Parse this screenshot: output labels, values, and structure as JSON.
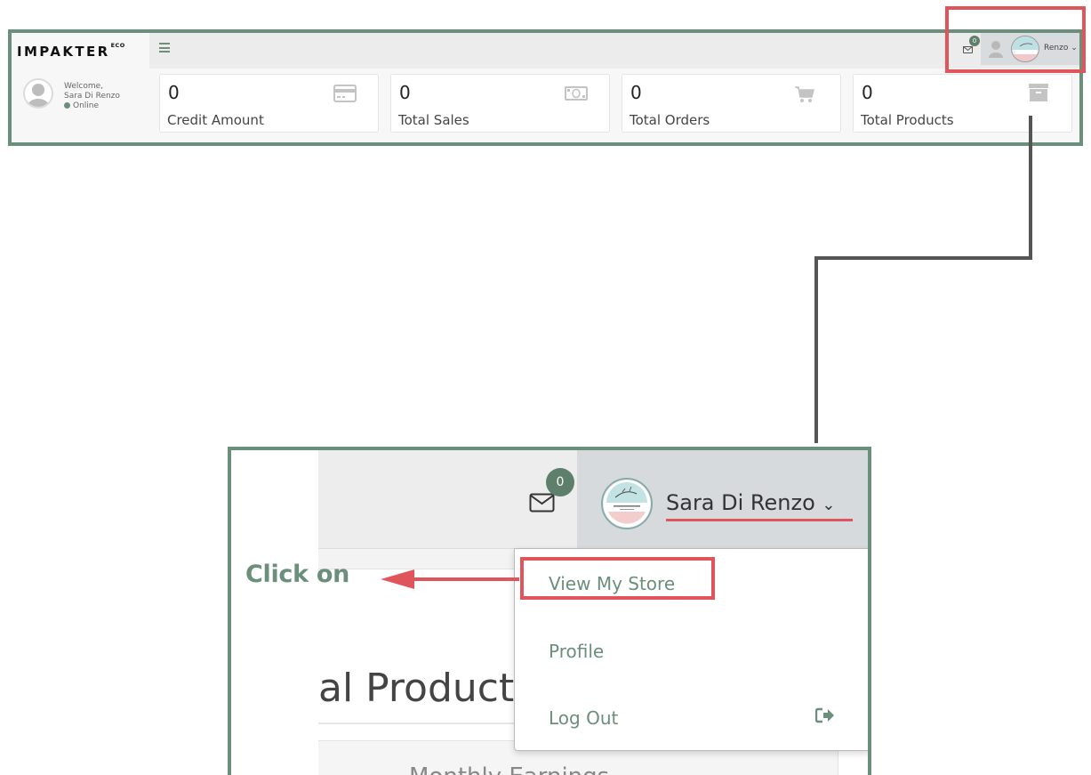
{
  "brand": {
    "name": "IMPAKTER",
    "suffix": "ECO"
  },
  "sidebar_user": {
    "welcome": "Welcome,",
    "name": "Sara Di Renzo",
    "status": "Online"
  },
  "header": {
    "messages_count": "0",
    "user_short": "Renzo"
  },
  "stats": [
    {
      "value": "0",
      "label": "Credit Amount",
      "icon": "credit-card-icon"
    },
    {
      "value": "0",
      "label": "Total Sales",
      "icon": "money-icon"
    },
    {
      "value": "0",
      "label": "Total Orders",
      "icon": "cart-icon"
    },
    {
      "value": "0",
      "label": "Total Products",
      "icon": "archive-icon"
    }
  ],
  "zoom": {
    "messages_count": "0",
    "user_name": "Sara Di Renzo",
    "background_heading": "al Product",
    "background_text": "Monthly Earnings",
    "menu": {
      "view_store": "View My Store",
      "profile": "Profile",
      "logout": "Log Out"
    }
  },
  "annotation": {
    "instruction": "Click on"
  },
  "colors": {
    "accent_green": "#6a8f7b",
    "highlight_red": "#e0555b",
    "badge_green": "#5e7f6c"
  }
}
